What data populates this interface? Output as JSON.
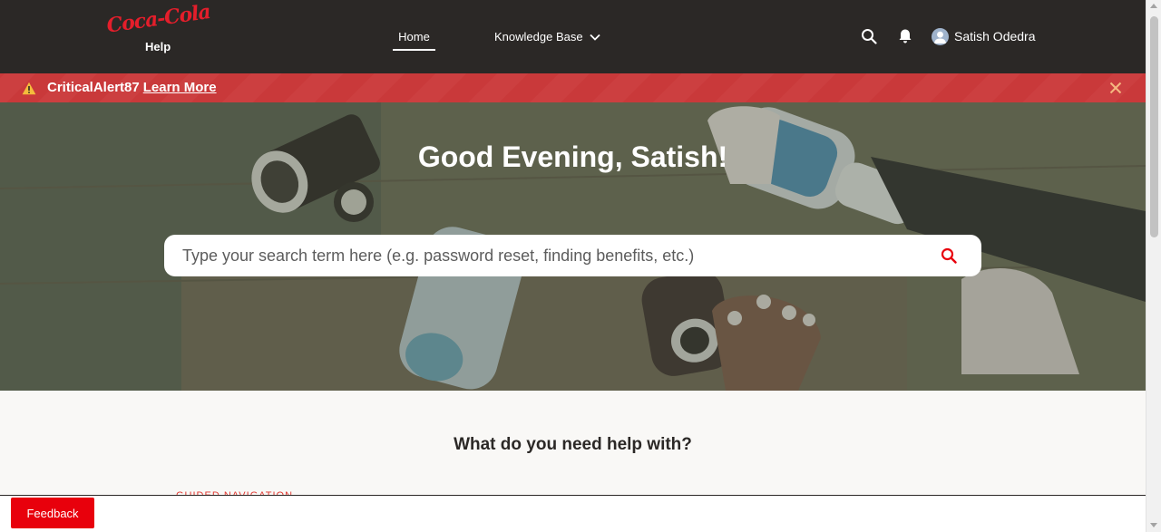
{
  "header": {
    "logo_wordmark": "Coca-Cola",
    "logo_sub": "Help",
    "nav": [
      {
        "label": "Home",
        "active": true
      },
      {
        "label": "Knowledge Base",
        "has_dropdown": true
      }
    ],
    "user_name": "Satish Odedra",
    "icons": [
      "search-icon",
      "bell-icon",
      "user-avatar-icon",
      "chevron-down-icon"
    ]
  },
  "alert": {
    "title": "CriticalAlert87",
    "link_label": "Learn More",
    "icons": [
      "warning-icon",
      "close-icon"
    ]
  },
  "hero": {
    "greeting": "Good Evening, Satish!",
    "search_placeholder": "Type your search term here (e.g. password reset, finding benefits, etc.)"
  },
  "main": {
    "section_title": "What do you need help with?",
    "section_label": "GUIDED NAVIGATION"
  },
  "footer": {
    "feedback_label": "Feedback"
  },
  "colors": {
    "header_bg": "#2b2826",
    "alert_bg": "#c9393a",
    "brand_red": "#e41e2b",
    "feedback_bg": "#e8000c",
    "search_icon": "#e8000c"
  }
}
